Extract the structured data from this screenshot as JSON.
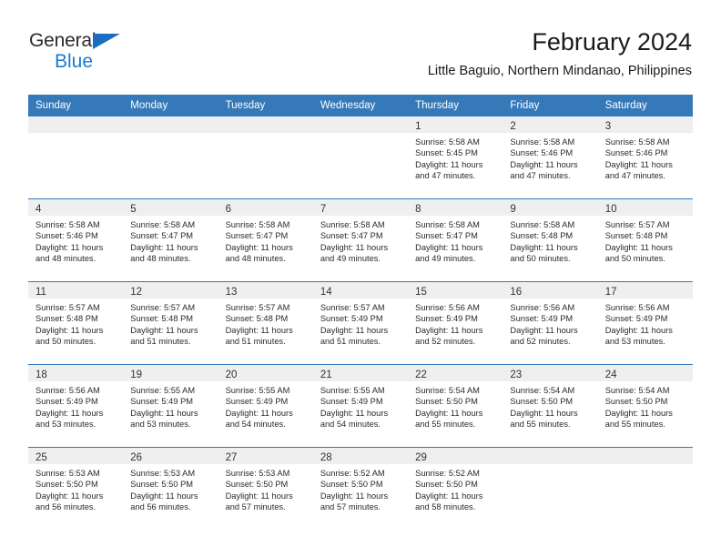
{
  "brand": {
    "name_top": "General",
    "name_bottom": "Blue",
    "triangle_color": "#1b6ec2",
    "blue_color": "#1b7ad0"
  },
  "header": {
    "title": "February 2024",
    "subtitle": "Little Baguio, Northern Mindanao, Philippines"
  },
  "theme": {
    "header_blue": "#3579b9",
    "day_band_gray": "#efefef",
    "text": "#2a2a2a"
  },
  "calendar": {
    "weekdays": [
      "Sunday",
      "Monday",
      "Tuesday",
      "Wednesday",
      "Thursday",
      "Friday",
      "Saturday"
    ],
    "weeks": [
      [
        {
          "day": "",
          "lines": []
        },
        {
          "day": "",
          "lines": []
        },
        {
          "day": "",
          "lines": []
        },
        {
          "day": "",
          "lines": []
        },
        {
          "day": "1",
          "lines": [
            "Sunrise: 5:58 AM",
            "Sunset: 5:45 PM",
            "Daylight: 11 hours",
            "and 47 minutes."
          ]
        },
        {
          "day": "2",
          "lines": [
            "Sunrise: 5:58 AM",
            "Sunset: 5:46 PM",
            "Daylight: 11 hours",
            "and 47 minutes."
          ]
        },
        {
          "day": "3",
          "lines": [
            "Sunrise: 5:58 AM",
            "Sunset: 5:46 PM",
            "Daylight: 11 hours",
            "and 47 minutes."
          ]
        }
      ],
      [
        {
          "day": "4",
          "lines": [
            "Sunrise: 5:58 AM",
            "Sunset: 5:46 PM",
            "Daylight: 11 hours",
            "and 48 minutes."
          ]
        },
        {
          "day": "5",
          "lines": [
            "Sunrise: 5:58 AM",
            "Sunset: 5:47 PM",
            "Daylight: 11 hours",
            "and 48 minutes."
          ]
        },
        {
          "day": "6",
          "lines": [
            "Sunrise: 5:58 AM",
            "Sunset: 5:47 PM",
            "Daylight: 11 hours",
            "and 48 minutes."
          ]
        },
        {
          "day": "7",
          "lines": [
            "Sunrise: 5:58 AM",
            "Sunset: 5:47 PM",
            "Daylight: 11 hours",
            "and 49 minutes."
          ]
        },
        {
          "day": "8",
          "lines": [
            "Sunrise: 5:58 AM",
            "Sunset: 5:47 PM",
            "Daylight: 11 hours",
            "and 49 minutes."
          ]
        },
        {
          "day": "9",
          "lines": [
            "Sunrise: 5:58 AM",
            "Sunset: 5:48 PM",
            "Daylight: 11 hours",
            "and 50 minutes."
          ]
        },
        {
          "day": "10",
          "lines": [
            "Sunrise: 5:57 AM",
            "Sunset: 5:48 PM",
            "Daylight: 11 hours",
            "and 50 minutes."
          ]
        }
      ],
      [
        {
          "day": "11",
          "lines": [
            "Sunrise: 5:57 AM",
            "Sunset: 5:48 PM",
            "Daylight: 11 hours",
            "and 50 minutes."
          ]
        },
        {
          "day": "12",
          "lines": [
            "Sunrise: 5:57 AM",
            "Sunset: 5:48 PM",
            "Daylight: 11 hours",
            "and 51 minutes."
          ]
        },
        {
          "day": "13",
          "lines": [
            "Sunrise: 5:57 AM",
            "Sunset: 5:48 PM",
            "Daylight: 11 hours",
            "and 51 minutes."
          ]
        },
        {
          "day": "14",
          "lines": [
            "Sunrise: 5:57 AM",
            "Sunset: 5:49 PM",
            "Daylight: 11 hours",
            "and 51 minutes."
          ]
        },
        {
          "day": "15",
          "lines": [
            "Sunrise: 5:56 AM",
            "Sunset: 5:49 PM",
            "Daylight: 11 hours",
            "and 52 minutes."
          ]
        },
        {
          "day": "16",
          "lines": [
            "Sunrise: 5:56 AM",
            "Sunset: 5:49 PM",
            "Daylight: 11 hours",
            "and 52 minutes."
          ]
        },
        {
          "day": "17",
          "lines": [
            "Sunrise: 5:56 AM",
            "Sunset: 5:49 PM",
            "Daylight: 11 hours",
            "and 53 minutes."
          ]
        }
      ],
      [
        {
          "day": "18",
          "lines": [
            "Sunrise: 5:56 AM",
            "Sunset: 5:49 PM",
            "Daylight: 11 hours",
            "and 53 minutes."
          ]
        },
        {
          "day": "19",
          "lines": [
            "Sunrise: 5:55 AM",
            "Sunset: 5:49 PM",
            "Daylight: 11 hours",
            "and 53 minutes."
          ]
        },
        {
          "day": "20",
          "lines": [
            "Sunrise: 5:55 AM",
            "Sunset: 5:49 PM",
            "Daylight: 11 hours",
            "and 54 minutes."
          ]
        },
        {
          "day": "21",
          "lines": [
            "Sunrise: 5:55 AM",
            "Sunset: 5:49 PM",
            "Daylight: 11 hours",
            "and 54 minutes."
          ]
        },
        {
          "day": "22",
          "lines": [
            "Sunrise: 5:54 AM",
            "Sunset: 5:50 PM",
            "Daylight: 11 hours",
            "and 55 minutes."
          ]
        },
        {
          "day": "23",
          "lines": [
            "Sunrise: 5:54 AM",
            "Sunset: 5:50 PM",
            "Daylight: 11 hours",
            "and 55 minutes."
          ]
        },
        {
          "day": "24",
          "lines": [
            "Sunrise: 5:54 AM",
            "Sunset: 5:50 PM",
            "Daylight: 11 hours",
            "and 55 minutes."
          ]
        }
      ],
      [
        {
          "day": "25",
          "lines": [
            "Sunrise: 5:53 AM",
            "Sunset: 5:50 PM",
            "Daylight: 11 hours",
            "and 56 minutes."
          ]
        },
        {
          "day": "26",
          "lines": [
            "Sunrise: 5:53 AM",
            "Sunset: 5:50 PM",
            "Daylight: 11 hours",
            "and 56 minutes."
          ]
        },
        {
          "day": "27",
          "lines": [
            "Sunrise: 5:53 AM",
            "Sunset: 5:50 PM",
            "Daylight: 11 hours",
            "and 57 minutes."
          ]
        },
        {
          "day": "28",
          "lines": [
            "Sunrise: 5:52 AM",
            "Sunset: 5:50 PM",
            "Daylight: 11 hours",
            "and 57 minutes."
          ]
        },
        {
          "day": "29",
          "lines": [
            "Sunrise: 5:52 AM",
            "Sunset: 5:50 PM",
            "Daylight: 11 hours",
            "and 58 minutes."
          ]
        },
        {
          "day": "",
          "lines": []
        },
        {
          "day": "",
          "lines": []
        }
      ]
    ]
  }
}
